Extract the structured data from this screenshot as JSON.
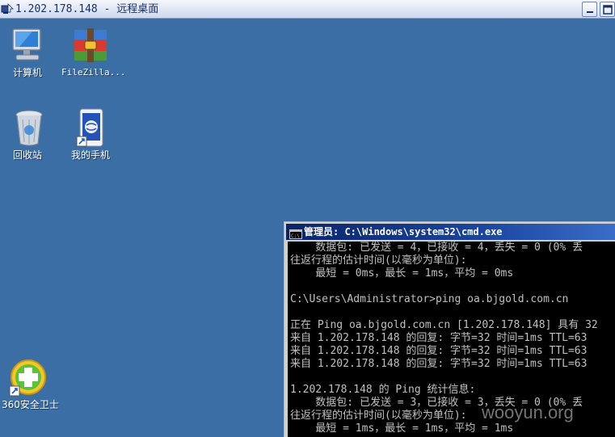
{
  "rdp": {
    "title": "1.202.178.148 - 远程桌面"
  },
  "desktop": {
    "icons": [
      {
        "label": "计算机",
        "icon": "computer-icon"
      },
      {
        "label": "FileZilla...",
        "icon": "filezilla-icon"
      },
      {
        "label": "回收站",
        "icon": "recycle-bin-icon"
      },
      {
        "label": "我的手机",
        "icon": "phone-icon"
      },
      {
        "label": "360安全卫士",
        "icon": "360-security-icon"
      }
    ]
  },
  "cmd": {
    "title": "管理员: C:\\Windows\\system32\\cmd.exe",
    "lines": [
      "    数据包: 已发送 = 4，已接收 = 4，丢失 = 0 (0% 丢",
      "往返行程的估计时间(以毫秒为单位):",
      "    最短 = 0ms，最长 = 1ms，平均 = 0ms",
      "",
      "C:\\Users\\Administrator>ping oa.bjgold.com.cn",
      "",
      "正在 Ping oa.bjgold.com.cn [1.202.178.148] 具有 32",
      "来自 1.202.178.148 的回复: 字节=32 时间=1ms TTL=63",
      "来自 1.202.178.148 的回复: 字节=32 时间=1ms TTL=63",
      "来自 1.202.178.148 的回复: 字节=32 时间=1ms TTL=63",
      "",
      "1.202.178.148 的 Ping 统计信息:",
      "    数据包: 已发送 = 3，已接收 = 3，丢失 = 0 (0% 丢",
      "往返行程的估计时间(以毫秒为单位):",
      "    最短 = 1ms，最长 = 1ms，平均 = 1ms"
    ]
  },
  "watermark": "wooyun.org",
  "colors": {
    "desktop": "#3a6ea5",
    "cmd_background": "#000000",
    "cmd_text": "#c0c0c0"
  }
}
